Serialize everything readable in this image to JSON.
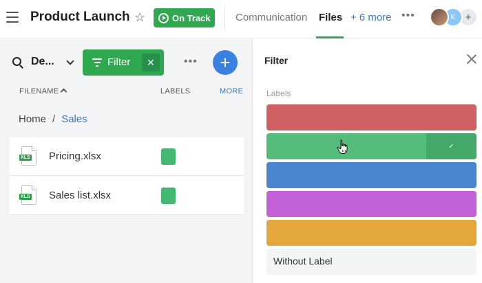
{
  "header": {
    "title": "Product Launch",
    "status": "On Track",
    "tabs": [
      {
        "label": "Communication"
      },
      {
        "label": "Files"
      },
      {
        "label": "+ 6 more"
      }
    ],
    "avatars": [
      {
        "initial": ""
      },
      {
        "initial": "K"
      },
      {
        "initial": "+"
      }
    ]
  },
  "toolbar": {
    "search_text": "De...",
    "filter_label": "Filter"
  },
  "columns": {
    "filename": "FILENAME",
    "labels": "LABELS",
    "more": "MORE"
  },
  "breadcrumb": {
    "home": "Home",
    "separator": "/",
    "current": "Sales"
  },
  "files": [
    {
      "name": "Pricing.xlsx",
      "type": "XLS",
      "label_color": "#44b872"
    },
    {
      "name": "Sales list.xlsx",
      "type": "XLS",
      "label_color": "#44b872"
    }
  ],
  "filter_panel": {
    "title": "Filter",
    "section_label": "Labels",
    "labels": [
      {
        "color": "#d06062",
        "selected": false
      },
      {
        "color": "#54bd7b",
        "selected": true
      },
      {
        "color": "#4a86cd",
        "selected": false
      },
      {
        "color": "#c262d6",
        "selected": false
      },
      {
        "color": "#e4a73d",
        "selected": false
      }
    ],
    "without_label": "Without Label"
  }
}
